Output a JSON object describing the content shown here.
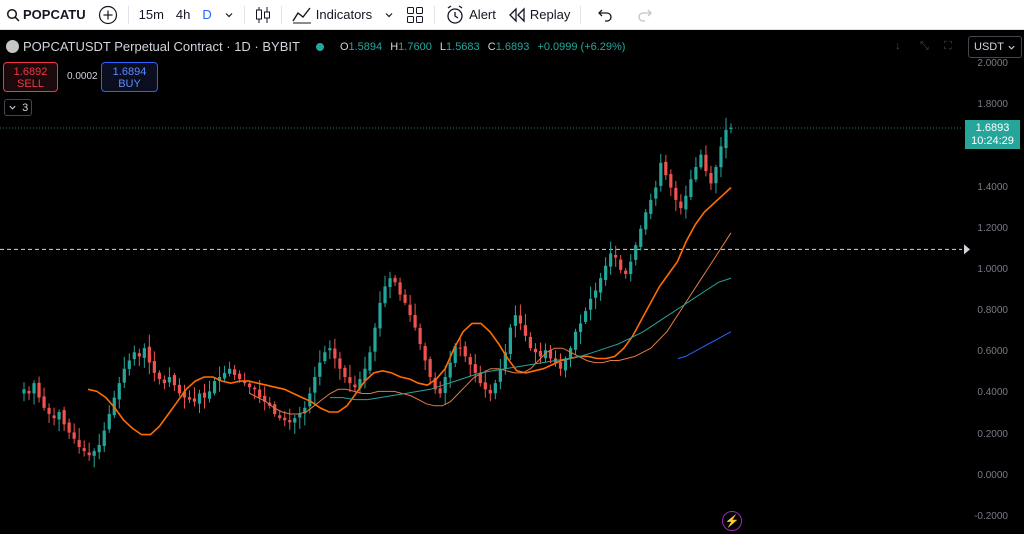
{
  "toolbar": {
    "symbol": "POPCATU",
    "timeframes": [
      "15m",
      "4h",
      "D"
    ],
    "active_timeframe": "D",
    "indicators_label": "Indicators",
    "alert_label": "Alert",
    "replay_label": "Replay"
  },
  "legend": {
    "title": "POPCATUSDT Perpetual Contract · 1D · BYBIT",
    "open_key": "O",
    "open": "1.5894",
    "high_key": "H",
    "high": "1.7600",
    "low_key": "L",
    "low": "1.5683",
    "close_key": "C",
    "close": "1.6893",
    "change": "+0.0999 (+6.29%)"
  },
  "trade": {
    "sell_price": "1.6892",
    "sell_label": "SELL",
    "spread": "0.0002",
    "buy_price": "1.6894",
    "buy_label": "BUY"
  },
  "indicator_count": "3",
  "currency": "USDT",
  "last_price": {
    "price": "1.6893",
    "countdown": "10:24:29"
  },
  "colors": {
    "up": "#26a69a",
    "down": "#ef5350",
    "ema_fast": "#ff6d00",
    "ema_mid": "#e07b46",
    "ema_slow": "#26a69a",
    "ema_long": "#2962ff"
  },
  "icons": [
    "search-icon",
    "plus-icon",
    "chevron-down-icon",
    "candles-icon",
    "indicators-icon",
    "layouts-icon",
    "alert-icon",
    "replay-icon",
    "undo-icon",
    "redo-icon",
    "flash-icon"
  ],
  "chart_data": {
    "type": "candlestick",
    "y_ticks": [
      "2.0000",
      "1.8000",
      "1.6000",
      "1.4000",
      "1.2000",
      "1.0000",
      "0.8000",
      "0.6000",
      "0.4000",
      "0.2000",
      "0.0000",
      "-0.2000"
    ],
    "ylim": [
      -0.2,
      2.0
    ],
    "horizontal_line_price": 1.1,
    "closes": [
      0.42,
      0.4,
      0.45,
      0.38,
      0.33,
      0.3,
      0.28,
      0.31,
      0.25,
      0.21,
      0.18,
      0.14,
      0.12,
      0.1,
      0.12,
      0.15,
      0.22,
      0.3,
      0.38,
      0.45,
      0.52,
      0.56,
      0.6,
      0.58,
      0.62,
      0.55,
      0.5,
      0.47,
      0.45,
      0.48,
      0.44,
      0.4,
      0.38,
      0.37,
      0.36,
      0.4,
      0.38,
      0.41,
      0.46,
      0.48,
      0.5,
      0.52,
      0.49,
      0.47,
      0.45,
      0.43,
      0.42,
      0.38,
      0.36,
      0.34,
      0.3,
      0.28,
      0.27,
      0.26,
      0.28,
      0.3,
      0.33,
      0.4,
      0.48,
      0.55,
      0.6,
      0.62,
      0.57,
      0.52,
      0.48,
      0.45,
      0.43,
      0.47,
      0.52,
      0.6,
      0.72,
      0.84,
      0.92,
      0.96,
      0.94,
      0.88,
      0.84,
      0.78,
      0.72,
      0.64,
      0.56,
      0.48,
      0.42,
      0.4,
      0.48,
      0.55,
      0.63,
      0.62,
      0.58,
      0.54,
      0.5,
      0.45,
      0.42,
      0.4,
      0.45,
      0.52,
      0.6,
      0.72,
      0.78,
      0.74,
      0.68,
      0.62,
      0.6,
      0.58,
      0.61,
      0.57,
      0.55,
      0.52,
      0.57,
      0.62,
      0.7,
      0.74,
      0.8,
      0.86,
      0.9,
      0.96,
      1.02,
      1.08,
      1.06,
      1.0,
      0.98,
      1.04,
      1.12,
      1.2,
      1.28,
      1.34,
      1.4,
      1.52,
      1.46,
      1.4,
      1.34,
      1.3,
      1.36,
      1.44,
      1.5,
      1.56,
      1.48,
      1.42,
      1.5,
      1.6,
      1.68,
      1.69
    ],
    "ema_fast": [
      0.42,
      0.41,
      0.38,
      0.33,
      0.27,
      0.23,
      0.2,
      0.2,
      0.24,
      0.3,
      0.36,
      0.42,
      0.46,
      0.48,
      0.48,
      0.46,
      0.45,
      0.46,
      0.46,
      0.45,
      0.44,
      0.43,
      0.42,
      0.4,
      0.38,
      0.36,
      0.33,
      0.31,
      0.31,
      0.34,
      0.4,
      0.46,
      0.5,
      0.51,
      0.5,
      0.48,
      0.47,
      0.45,
      0.44,
      0.47,
      0.52,
      0.62,
      0.7,
      0.74,
      0.74,
      0.7,
      0.64,
      0.57,
      0.51,
      0.5,
      0.51,
      0.52,
      0.54,
      0.56,
      0.57,
      0.58,
      0.58,
      0.57,
      0.57,
      0.58,
      0.62,
      0.68,
      0.76,
      0.84,
      0.92,
      0.98,
      1.04,
      1.14,
      1.22,
      1.28,
      1.32,
      1.36,
      1.4
    ],
    "ema_mid": [
      0.4,
      0.38,
      0.36,
      0.33,
      0.31,
      0.3,
      0.3,
      0.31,
      0.34,
      0.37,
      0.4,
      0.42,
      0.42,
      0.41,
      0.4,
      0.4,
      0.41,
      0.41,
      0.41,
      0.4,
      0.39,
      0.37,
      0.35,
      0.34,
      0.34,
      0.36,
      0.4,
      0.44,
      0.48,
      0.5,
      0.52,
      0.52,
      0.51,
      0.5,
      0.5,
      0.52,
      0.56,
      0.6,
      0.62,
      0.62,
      0.6,
      0.58,
      0.56,
      0.55,
      0.55,
      0.56,
      0.56,
      0.57,
      0.58,
      0.6,
      0.62,
      0.66,
      0.7,
      0.76,
      0.82,
      0.88,
      0.94,
      1.0,
      1.06,
      1.12,
      1.18
    ],
    "ema_slow": [
      0.38,
      0.38,
      0.37,
      0.37,
      0.38,
      0.39,
      0.4,
      0.41,
      0.42,
      0.44,
      0.46,
      0.48,
      0.5,
      0.51,
      0.52,
      0.53,
      0.54,
      0.55,
      0.56,
      0.57,
      0.58,
      0.6,
      0.62,
      0.64,
      0.67,
      0.7,
      0.74,
      0.78,
      0.82,
      0.86,
      0.9,
      0.94,
      0.96
    ],
    "ema_long": [
      0.57,
      0.58,
      0.6,
      0.62,
      0.64,
      0.66,
      0.68,
      0.7
    ]
  }
}
